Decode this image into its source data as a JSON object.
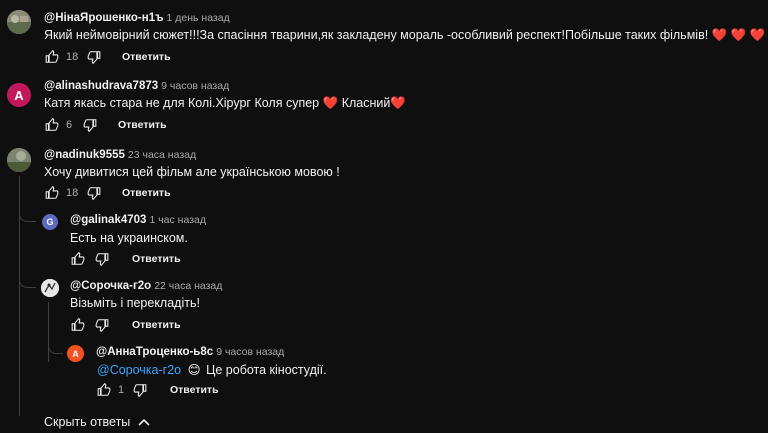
{
  "comments": [
    {
      "author": "@НінаЯрошенко-н1ъ",
      "time": "1 день назад",
      "text": "Який неймовірний сюжет!!!За спасіння тварини,як закладену мораль -особливий респект!Побільше таких фільмів!",
      "hearts": "❤️ ❤️ ❤️",
      "likes": "18",
      "reply_label": "Ответить",
      "avatar_letter": "",
      "avatar_color": "#7a7a6a"
    },
    {
      "author": "@alinashudrava7873",
      "time": "9 часов назад",
      "text": "Катя якась стара не для Колі.Хірург Коля супер",
      "text_mid": "Класний",
      "likes": "6",
      "reply_label": "Ответить",
      "avatar_letter": "A",
      "avatar_color": "#c2185b"
    },
    {
      "author": "@nadinuk9555",
      "time": "23 часа назад",
      "text": "Хочу дивитися цей фільм але українською мовою !",
      "likes": "18",
      "reply_label": "Ответить",
      "avatar_letter": "",
      "avatar_color": "#6b7560"
    }
  ],
  "replies": [
    {
      "author": "@galinak4703",
      "time": "1 час назад",
      "text": "Есть на украинском.",
      "likes": "",
      "reply_label": "Ответить",
      "avatar_letter": "G",
      "avatar_color": "#5c6bc0"
    },
    {
      "author": "@Сорочка-г2о",
      "time": "22 часа назад",
      "text": "Візьміть і перекладіть!",
      "likes": "",
      "reply_label": "Ответить",
      "avatar_letter": "",
      "avatar_color": "#d8d8d8"
    },
    {
      "author": "@АннаТроценко-ь8с",
      "time": "9 часов назад",
      "mention": "@Сорочка-г2о",
      "emoji": "😊",
      "text": "Це робота кіностудії.",
      "likes": "1",
      "reply_label": "Ответить",
      "avatar_letter": "А",
      "avatar_color": "#f4511e"
    }
  ],
  "hide_replies": {
    "label": "Скрыть ответы",
    "icon": "chevron-up-icon"
  },
  "icons": {
    "like": "thumbs-up-icon",
    "dislike": "thumbs-down-icon"
  }
}
